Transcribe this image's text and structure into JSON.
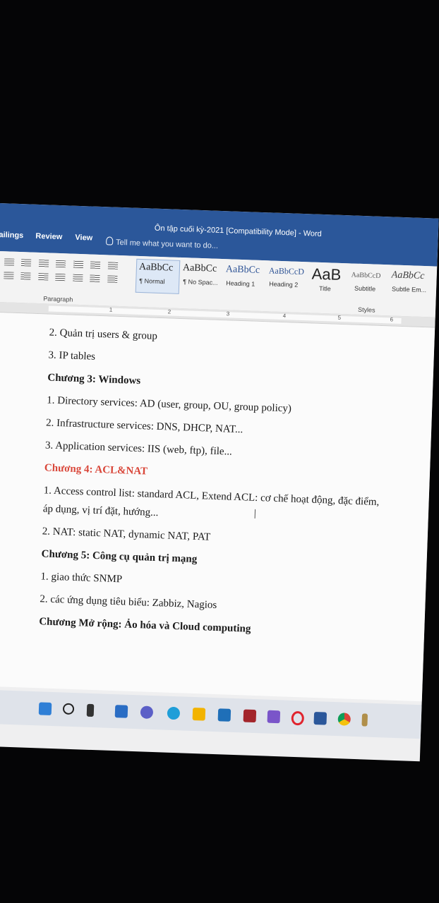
{
  "window": {
    "title": "Ôn tập cuối kỳ-2021 [Compatibility Mode] - Word"
  },
  "tabs": [
    "ailings",
    "Review",
    "View"
  ],
  "tell_me": "Tell me what you want to do...",
  "ribbon": {
    "paragraph_label": "Paragraph",
    "styles_label": "Styles",
    "styles": [
      {
        "sample": "AaBbCc",
        "name": "¶ Normal"
      },
      {
        "sample": "AaBbCc",
        "name": "¶ No Spac..."
      },
      {
        "sample": "AaBbCc",
        "name": "Heading 1"
      },
      {
        "sample": "AaBbCcD",
        "name": "Heading 2"
      },
      {
        "sample": "AaB",
        "name": "Title"
      },
      {
        "sample": "AaBbCcD",
        "name": "Subtitle"
      },
      {
        "sample": "AaBbCc",
        "name": "Subtle Em..."
      }
    ]
  },
  "ruler": [
    "1",
    "2",
    "3",
    "4",
    "5",
    "6"
  ],
  "document": {
    "lines": [
      "2. Quản trị users & group",
      "3. IP tables",
      "Chương 3: Windows",
      "1. Directory services: AD (user, group, OU, group policy)",
      "2. Infrastructure services: DNS, DHCP, NAT...",
      "3. Application services: IIS (web, ftp), file...",
      "Chương 4: ACL&NAT",
      "1. Access control list: standard ACL, Extend ACL: cơ chế hoạt động, đặc điểm,",
      "áp dụng, vị trí đặt, hướng...",
      "2. NAT: static NAT, dynamic NAT, PAT",
      "Chương 5: Công cụ quản trị mạng",
      "1. giao thức SNMP",
      "2. các ứng dụng tiêu biểu: Zabbiz, Nagios",
      "Chương Mở rộng: Ảo hóa và Cloud computing"
    ]
  },
  "colors": {
    "word_blue": "#2b579a",
    "heading_red": "#d9473a"
  },
  "taskbar": {
    "icons": [
      "windows-start-icon",
      "search-icon",
      "task-view-icon",
      "widgets-icon",
      "chat-icon",
      "edge-icon",
      "file-explorer-icon",
      "mail-icon",
      "store-icon",
      "visual-studio-icon",
      "opera-icon",
      "word-icon",
      "chrome-icon",
      "pin-icon"
    ]
  }
}
